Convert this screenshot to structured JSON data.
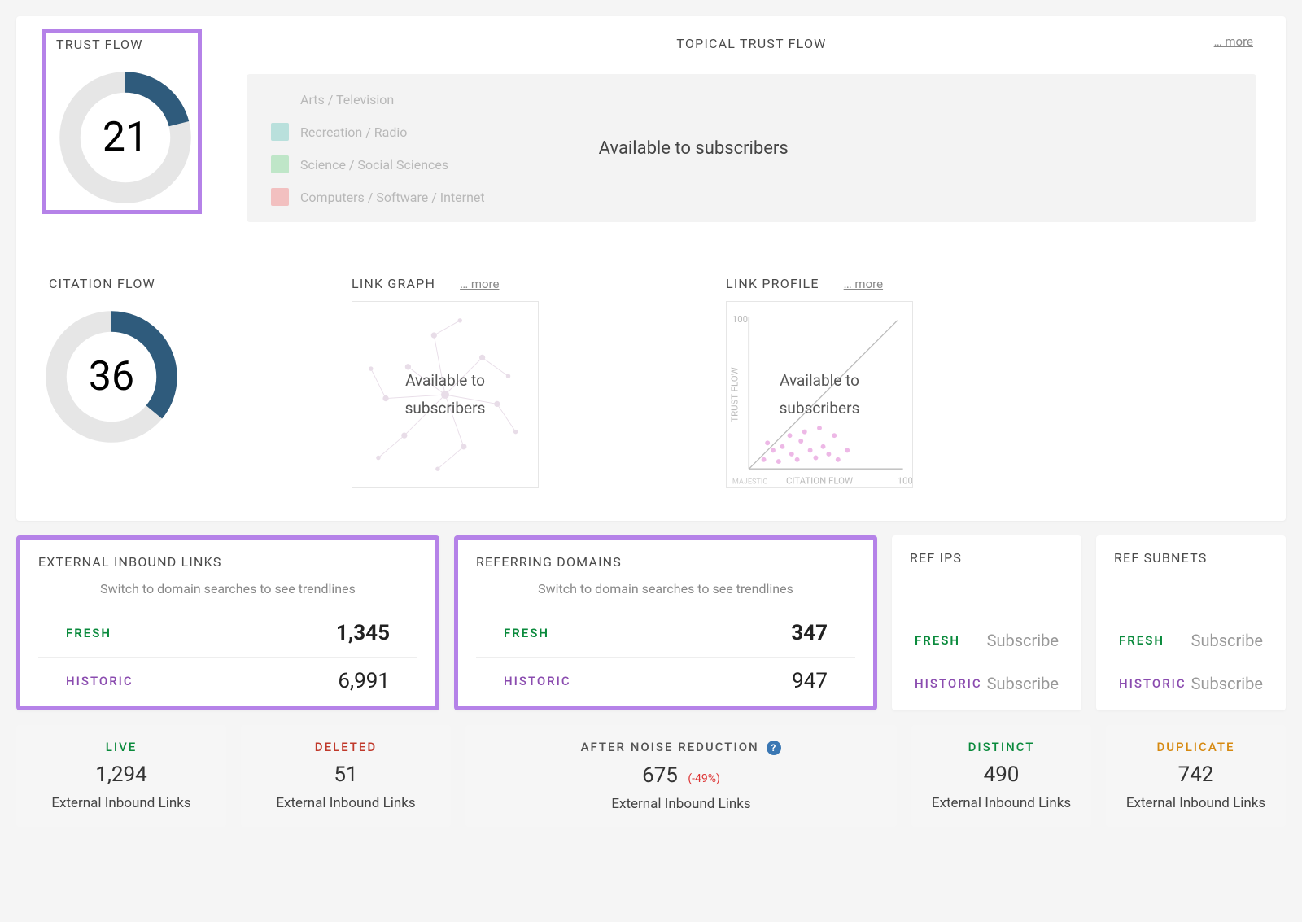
{
  "trust_flow": {
    "title": "TRUST FLOW",
    "value": 21,
    "color": "#2f5b7c"
  },
  "citation_flow": {
    "title": "CITATION FLOW",
    "value": 36,
    "color": "#2f5b7c"
  },
  "topical": {
    "title": "TOPICAL TRUST FLOW",
    "more": "… more",
    "overlay": "Available to subscribers",
    "topics": [
      {
        "label": "Arts / Television",
        "color": "#f5b58a"
      },
      {
        "label": "Recreation / Radio",
        "color": "#9fd7d1"
      },
      {
        "label": "Science / Social Sciences",
        "color": "#a8e0b5"
      },
      {
        "label": "Computers / Software / Internet",
        "color": "#f1a9a9"
      }
    ]
  },
  "link_graph": {
    "title": "LINK GRAPH",
    "more": "… more",
    "overlay1": "Available to",
    "overlay2": "subscribers"
  },
  "link_profile": {
    "title": "LINK PROFILE",
    "more": "… more",
    "overlay1": "Available to",
    "overlay2": "subscribers",
    "xlabel": "CITATION FLOW",
    "ylabel": "TRUST FLOW",
    "max": "100",
    "watermark": "MAJESTIC"
  },
  "external_inbound": {
    "title": "EXTERNAL INBOUND LINKS",
    "hint": "Switch to domain searches to see trendlines",
    "fresh": "1,345",
    "historic": "6,991",
    "label_fresh": "FRESH",
    "label_historic": "HISTORIC"
  },
  "referring_domains": {
    "title": "REFERRING DOMAINS",
    "hint": "Switch to domain searches to see trendlines",
    "fresh": "347",
    "historic": "947",
    "label_fresh": "FRESH",
    "label_historic": "HISTORIC"
  },
  "ref_ips": {
    "title": "REF IPS",
    "fresh": "Subscribe",
    "historic": "Subscribe",
    "label_fresh": "FRESH",
    "label_historic": "HISTORIC"
  },
  "ref_subnets": {
    "title": "REF SUBNETS",
    "fresh": "Subscribe",
    "historic": "Subscribe",
    "label_fresh": "FRESH",
    "label_historic": "HISTORIC"
  },
  "tiles": {
    "live": {
      "label": "LIVE",
      "value": "1,294",
      "sub": "External Inbound Links"
    },
    "deleted": {
      "label": "DELETED",
      "value": "51",
      "sub": "External Inbound Links"
    },
    "noise": {
      "label": "AFTER NOISE REDUCTION",
      "value": "675",
      "pct": "(-49%)",
      "sub": "External Inbound Links"
    },
    "distinct": {
      "label": "DISTINCT",
      "value": "490",
      "sub": "External Inbound Links"
    },
    "duplicate": {
      "label": "DUPLICATE",
      "value": "742",
      "sub": "External Inbound Links"
    }
  },
  "chart_data": [
    {
      "type": "donut",
      "title": "TRUST FLOW",
      "value": 21,
      "max": 100,
      "series": [
        {
          "name": "Trust Flow",
          "values": [
            21
          ]
        }
      ],
      "color_fill": "#2f5b7c",
      "color_track": "#e6e6e6"
    },
    {
      "type": "donut",
      "title": "CITATION FLOW",
      "value": 36,
      "max": 100,
      "series": [
        {
          "name": "Citation Flow",
          "values": [
            36
          ]
        }
      ],
      "color_fill": "#2f5b7c",
      "color_track": "#e6e6e6"
    },
    {
      "type": "scatter",
      "title": "LINK PROFILE",
      "xlabel": "CITATION FLOW",
      "ylabel": "TRUST FLOW",
      "xlim": [
        0,
        100
      ],
      "ylim": [
        0,
        100
      ],
      "note": "Data obscured — available to subscribers"
    }
  ]
}
